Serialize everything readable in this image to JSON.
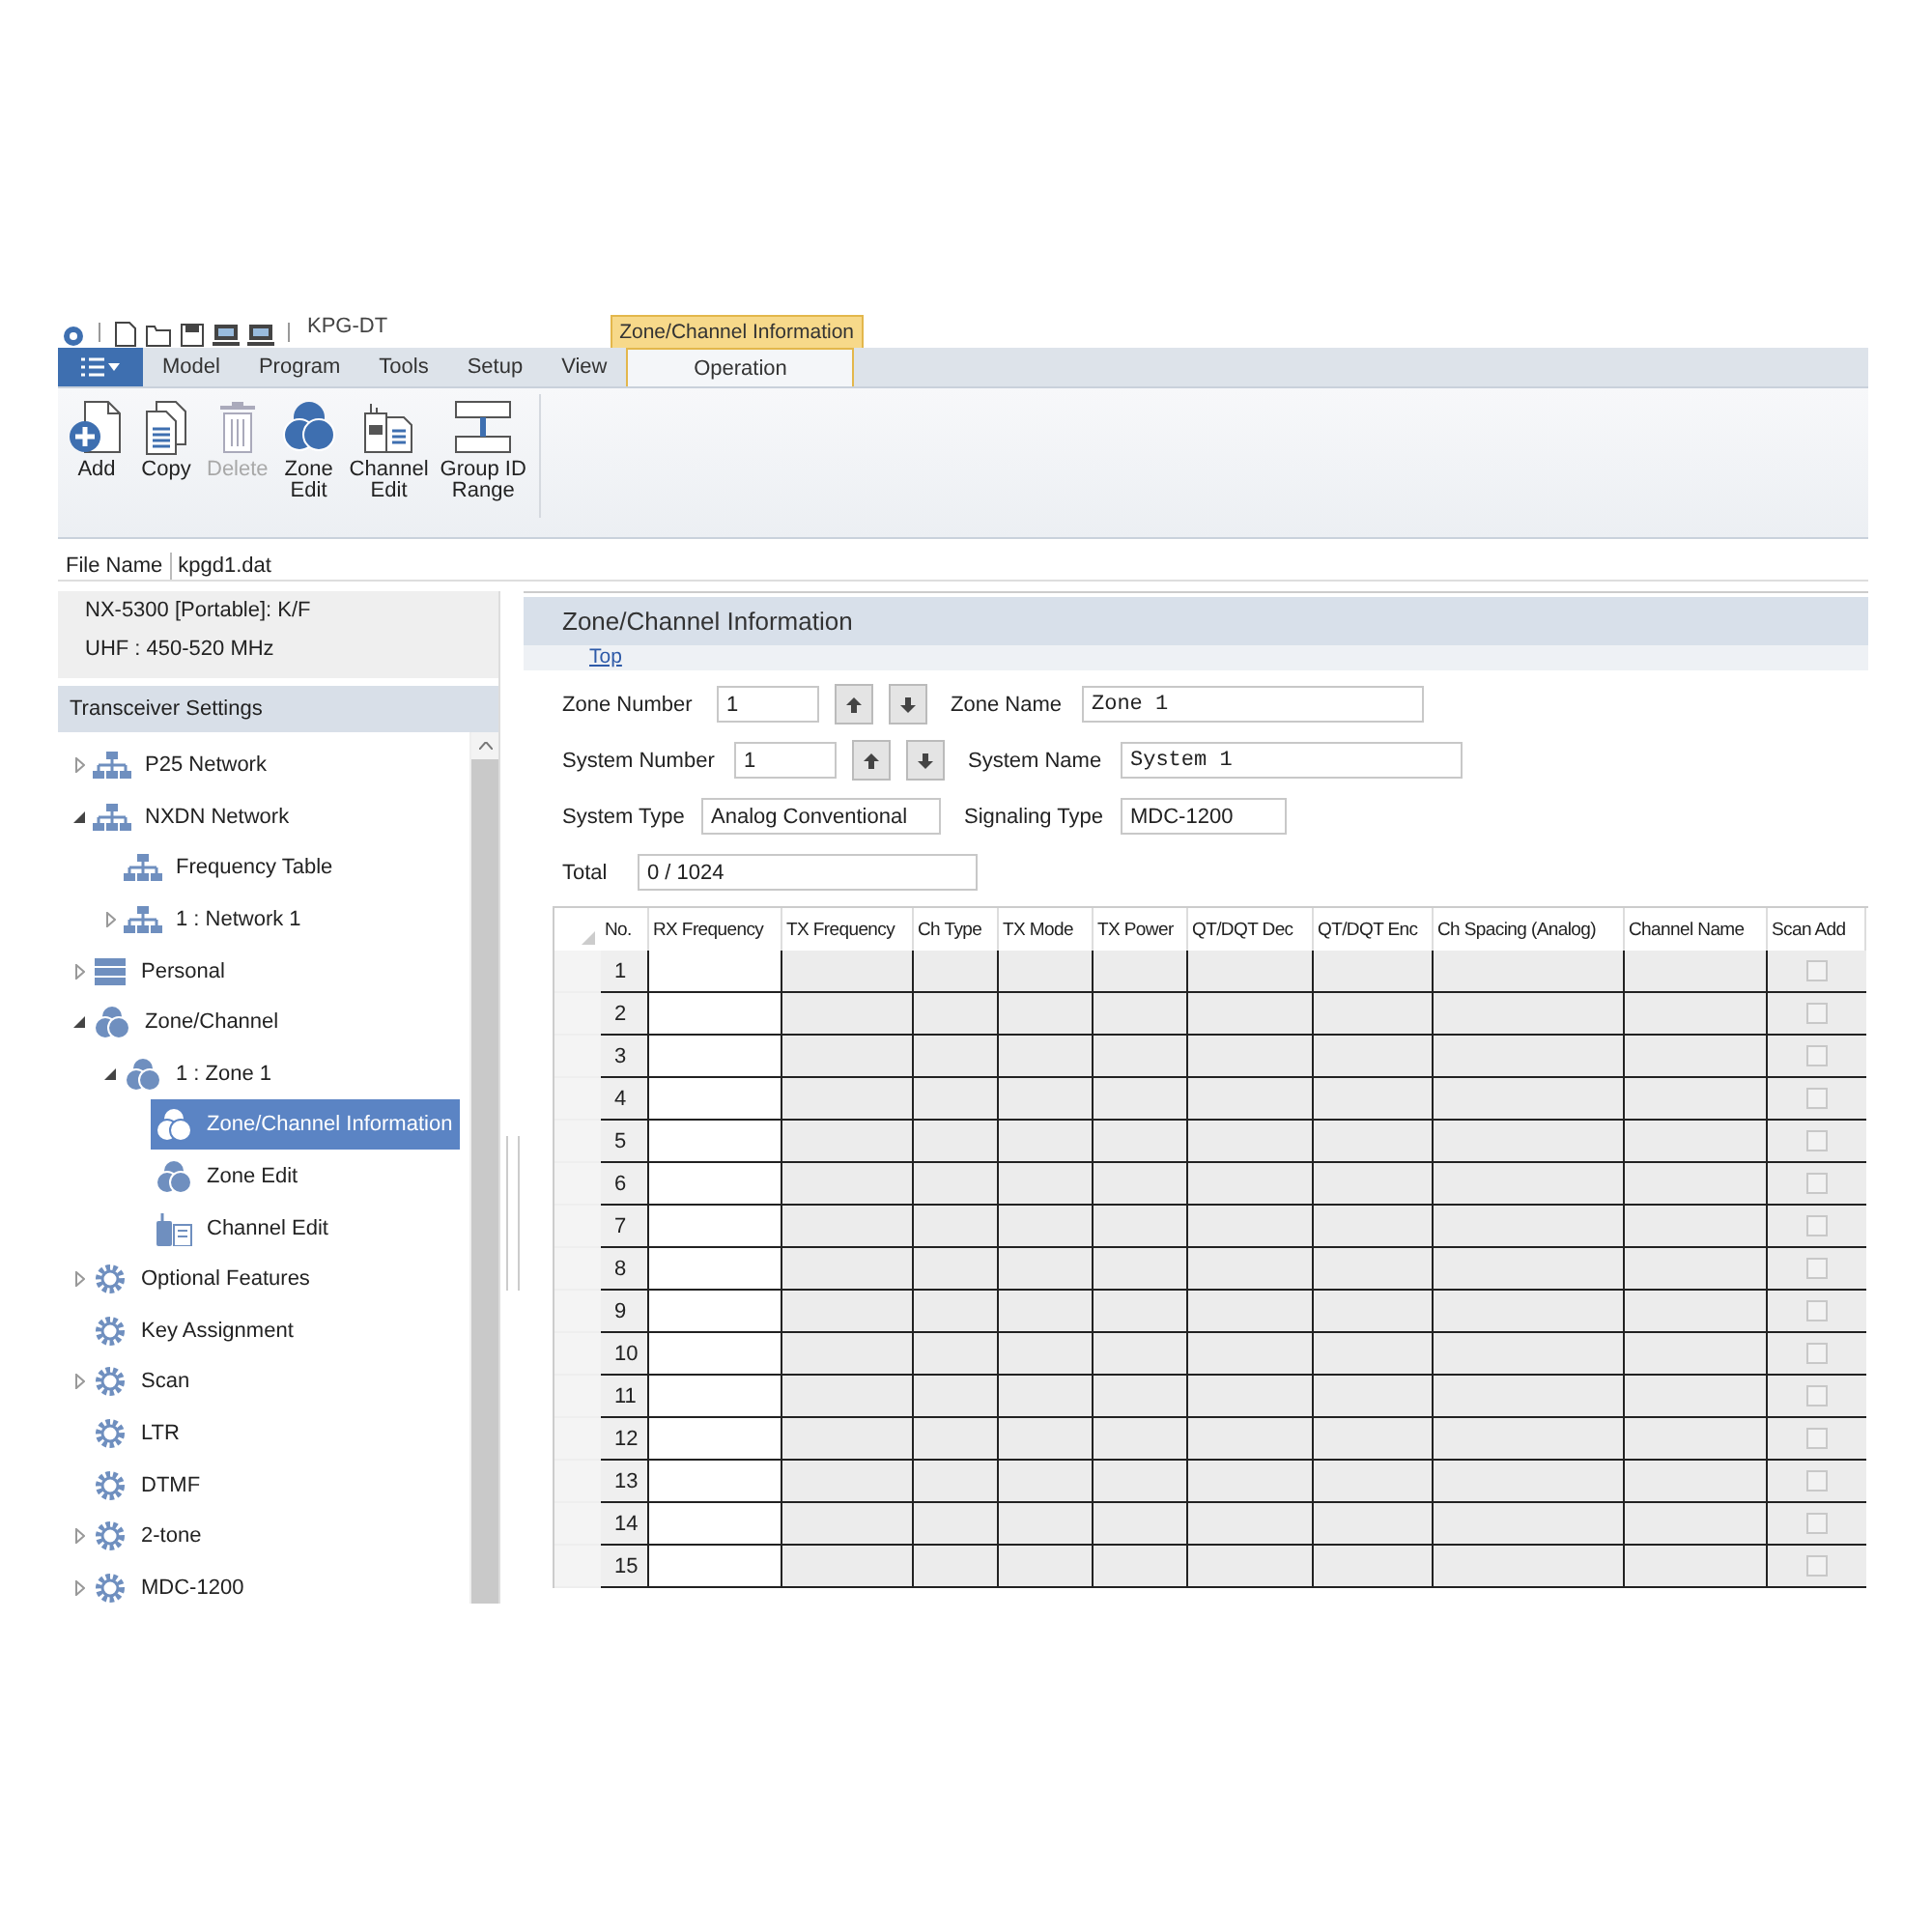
{
  "window": {
    "title": "KPG-DT"
  },
  "ribbon": {
    "contextual_tab": "Zone/Channel Information",
    "tabs": [
      {
        "label": "Model",
        "selected": false
      },
      {
        "label": "Program",
        "selected": false
      },
      {
        "label": "Tools",
        "selected": false
      },
      {
        "label": "Setup",
        "selected": false
      },
      {
        "label": "View",
        "selected": false
      },
      {
        "label": "Operation",
        "selected": true
      }
    ],
    "buttons": [
      {
        "label": "Add",
        "kind": "add",
        "disabled": false
      },
      {
        "label": "Copy",
        "kind": "copy",
        "disabled": false
      },
      {
        "label": "Delete",
        "kind": "delete",
        "disabled": true
      },
      {
        "label": "Zone\nEdit",
        "kind": "zone",
        "disabled": false
      },
      {
        "label": "Channel\nEdit",
        "kind": "channel",
        "disabled": false
      },
      {
        "label": "Group ID\nRange",
        "kind": "range",
        "disabled": false
      }
    ]
  },
  "file_name": {
    "label": "File Name",
    "value": "kpgd1.dat"
  },
  "model_info": [
    "NX-5300 [Portable]: K/F",
    "UHF : 450-520 MHz"
  ],
  "sidebar": {
    "title": "Transceiver Settings",
    "items": [
      {
        "label": "P25 Network",
        "kind": "network",
        "expanded": false,
        "selected": false
      },
      {
        "label": "NXDN Network",
        "kind": "network",
        "expanded": true,
        "selected": false,
        "children": [
          {
            "label": "Frequency Table",
            "kind": "network",
            "selected": false
          },
          {
            "label": "1 : Network 1",
            "kind": "network",
            "expanded": false,
            "selected": false
          }
        ]
      },
      {
        "label": "Personal",
        "kind": "list",
        "expanded": false,
        "selected": false
      },
      {
        "label": "Zone/Channel",
        "kind": "zone",
        "expanded": true,
        "selected": false,
        "children": [
          {
            "label": "1 : Zone 1",
            "kind": "zone",
            "expanded": true,
            "selected": false,
            "children": [
              {
                "label": "Zone/Channel Information",
                "kind": "zone",
                "selected": true
              },
              {
                "label": "Zone Edit",
                "kind": "zone",
                "selected": false
              },
              {
                "label": "Channel Edit",
                "kind": "radio",
                "selected": false
              }
            ]
          }
        ]
      },
      {
        "label": "Optional Features",
        "kind": "gear",
        "expanded": false,
        "selected": false
      },
      {
        "label": "Key Assignment",
        "kind": "gear",
        "selected": false
      },
      {
        "label": "Scan",
        "kind": "gear",
        "expanded": false,
        "selected": false
      },
      {
        "label": "LTR",
        "kind": "gear",
        "selected": false
      },
      {
        "label": "DTMF",
        "kind": "gear",
        "selected": false
      },
      {
        "label": "2-tone",
        "kind": "gear",
        "expanded": false,
        "selected": false
      },
      {
        "label": "MDC-1200",
        "kind": "gear",
        "expanded": false,
        "selected": false
      }
    ]
  },
  "panel": {
    "title": "Zone/Channel Information",
    "link": "Top",
    "fields": [
      [
        {
          "label": "Zone Number",
          "value": "1",
          "kind": "number"
        },
        {
          "label": "Zone Name",
          "value": "Zone 1",
          "kind": "mono"
        }
      ],
      [
        {
          "label": "System Number",
          "value": "1",
          "kind": "number"
        },
        {
          "label": "System Name",
          "value": "System 1",
          "kind": "mono"
        }
      ],
      [
        {
          "label": "System Type",
          "value": "Analog Conventional",
          "kind": "text"
        },
        {
          "label": "Signaling Type",
          "value": "MDC-1200",
          "kind": "short"
        }
      ],
      [
        {
          "label": "Total",
          "value": "0 / 1024",
          "kind": "wide"
        }
      ]
    ],
    "table": {
      "columns": [
        "No.",
        "RX Frequency",
        "TX Frequency",
        "Ch Type",
        "TX Mode",
        "TX Power",
        "QT/DQT Dec",
        "QT/DQT Enc",
        "Ch Spacing (Analog)",
        "Channel Name",
        "Scan Add"
      ],
      "rows": [
        {
          "no": "1",
          "scan_add": false
        },
        {
          "no": "2",
          "scan_add": false
        },
        {
          "no": "3",
          "scan_add": false
        },
        {
          "no": "4",
          "scan_add": false
        },
        {
          "no": "5",
          "scan_add": false
        },
        {
          "no": "6",
          "scan_add": false
        },
        {
          "no": "7",
          "scan_add": false
        },
        {
          "no": "8",
          "scan_add": false
        },
        {
          "no": "9",
          "scan_add": false
        },
        {
          "no": "10",
          "scan_add": false
        },
        {
          "no": "11",
          "scan_add": false
        },
        {
          "no": "12",
          "scan_add": false
        },
        {
          "no": "13",
          "scan_add": false
        },
        {
          "no": "14",
          "scan_add": false
        },
        {
          "no": "15",
          "scan_add": false
        }
      ]
    }
  }
}
